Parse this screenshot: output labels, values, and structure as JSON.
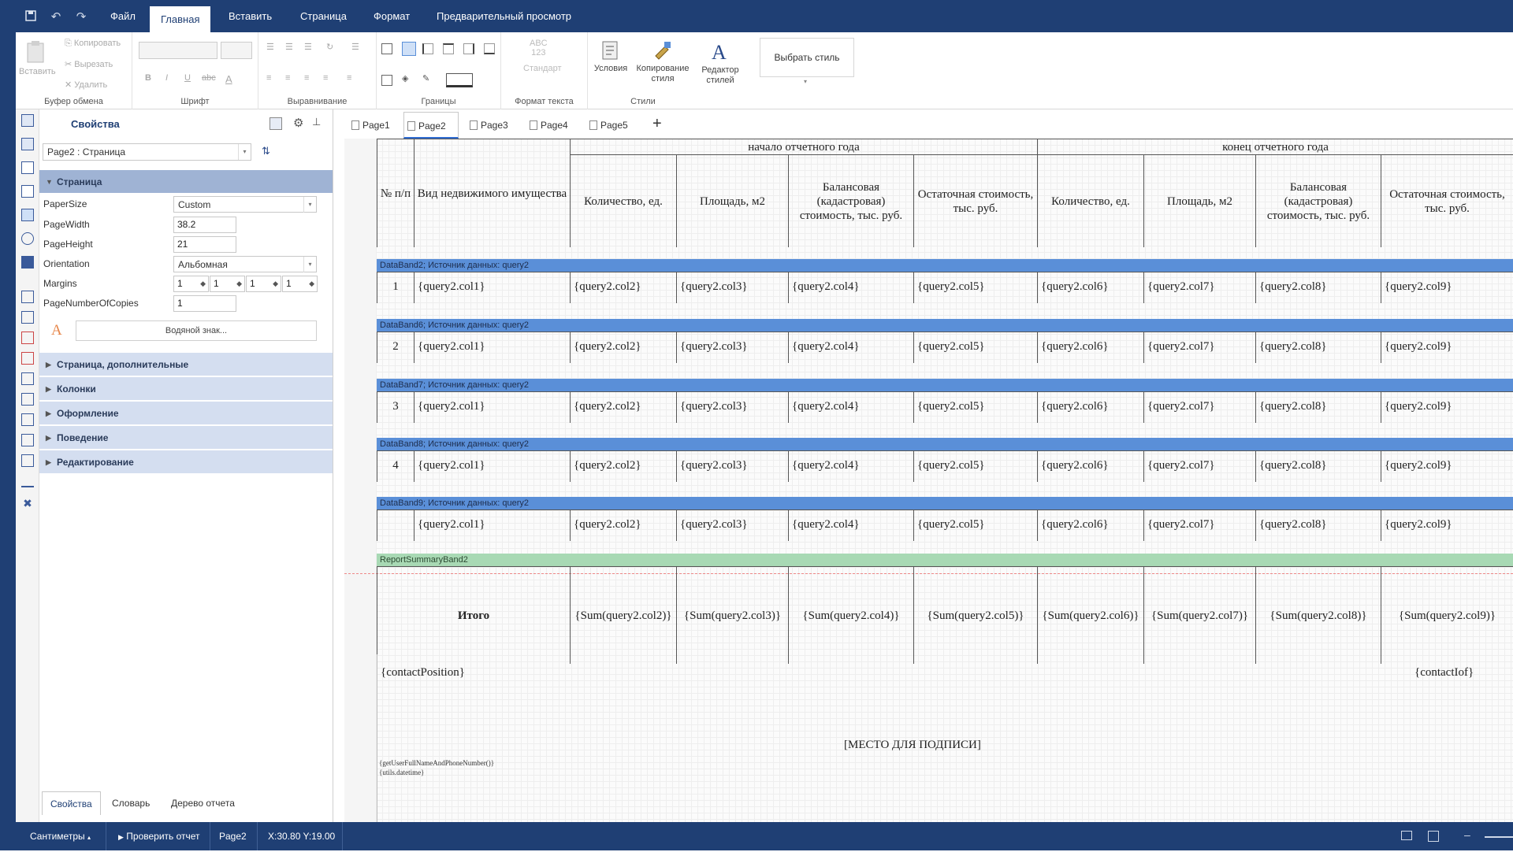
{
  "titlebar": {
    "menus": [
      "Файл",
      "Главная",
      "Вставить",
      "Страница",
      "Формат",
      "Предварительный просмотр"
    ],
    "active_menu": "Главная"
  },
  "ribbon": {
    "clipboard": {
      "paste": "Вставить",
      "copy": "Копировать",
      "cut": "Вырезать",
      "delete": "Удалить",
      "label": "Буфер обмена"
    },
    "font": {
      "label": "Шрифт"
    },
    "align": {
      "label": "Выравнивание"
    },
    "borders": {
      "label": "Границы"
    },
    "textformat": {
      "abc": "ABC",
      "num": "123",
      "standard": "Стандарт",
      "label": "Формат текста"
    },
    "styles": {
      "conditions": "Условия",
      "copy_style_1": "Копирование",
      "copy_style_2": "стиля",
      "editor_1": "Редактор",
      "editor_2": "стилей",
      "choose": "Выбрать стиль",
      "label": "Стили"
    }
  },
  "props": {
    "title": "Свойства",
    "selector": "Page2 : Страница",
    "page_category": "Страница",
    "fields": [
      {
        "label": "PaperSize",
        "value": "Custom"
      },
      {
        "label": "PageWidth",
        "value": "38.2"
      },
      {
        "label": "PageHeight",
        "value": "21"
      },
      {
        "label": "Orientation",
        "value": "Альбомная"
      },
      {
        "label": "Margins",
        "value": "1"
      },
      {
        "label": "PageNumberOfCopies",
        "value": "1"
      }
    ],
    "margins": [
      "1",
      "1",
      "1",
      "1"
    ],
    "watermark": "Водяной знак...",
    "categories": [
      "Страница, дополнительные",
      "Колонки",
      "Оформление",
      "Поведение",
      "Редактирование"
    ],
    "bottom_tabs": [
      "Свойства",
      "Словарь",
      "Дерево отчета"
    ]
  },
  "pagetabs": [
    "Page1",
    "Page2",
    "Page3",
    "Page4",
    "Page5"
  ],
  "active_page": "Page2",
  "report": {
    "header": {
      "num": "№ п/п",
      "type": "Вид недвижимого имущества",
      "start_year": "начало отчетного года",
      "end_year": "конец отчетного года",
      "qty": "Количество, ед.",
      "area": "Площадь, м2",
      "balance": "Балансовая (кадастровая) стоимость, тыс. руб.",
      "residual": "Остаточная стоимость, тыс. руб."
    },
    "bands": [
      {
        "label": "DataBand2; Источник данных: query2",
        "num": "1"
      },
      {
        "label": "DataBand6; Источник данных: query2",
        "num": "2"
      },
      {
        "label": "DataBand7; Источник данных: query2",
        "num": "3"
      },
      {
        "label": "DataBand8; Источник данных: query2",
        "num": "4"
      },
      {
        "label": "DataBand9; Источник данных: query2",
        "num": ""
      }
    ],
    "cols": [
      "{query2.col1}",
      "{query2.col2}",
      "{query2.col3}",
      "{query2.col4}",
      "{query2.col5}",
      "{query2.col6}",
      "{query2.col7}",
      "{query2.col8}",
      "{query2.col9}"
    ],
    "summary_band": "ReportSummaryBand2",
    "total_label": "Итого",
    "sums": [
      "{Sum(query2.col2)}",
      "{Sum(query2.col3)}",
      "{Sum(query2.col4)}",
      "{Sum(query2.col5)}",
      "{Sum(query2.col6)}",
      "{Sum(query2.col7)}",
      "{Sum(query2.col8)}",
      "{Sum(query2.col9)}"
    ],
    "contact_position": "{contactPosition}",
    "contact_iof": "{contactIof}",
    "signature": "[МЕСТО ДЛЯ ПОДПИСИ]",
    "user_fn": "{getUserFullNameAndPhoneNumber()}",
    "utils_dt": "{utils.datetime}"
  },
  "statusbar": {
    "units": "Сантиметры",
    "check": "Проверить отчет",
    "page": "Page2",
    "coords": "X:30.80 Y:19.00"
  },
  "colors": {
    "brand": "#1f3f74",
    "band": "#5a8fd8",
    "summary": "#a8d9b4",
    "category": "#d4def0"
  }
}
